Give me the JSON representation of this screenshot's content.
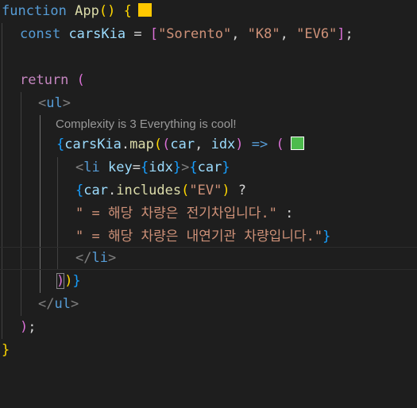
{
  "codelens": "Complexity is 3 Everything is cool!",
  "colors": {
    "color_swatch_1": "#ffc800",
    "color_swatch_2": "#4dbb4d"
  },
  "lines": {
    "l1": {
      "t1": "function",
      "t2": " ",
      "t3": "App",
      "t4": "()",
      "t5": " ",
      "t6": "{"
    },
    "l2": {
      "t1": "const",
      "t2": " ",
      "t3": "carsKia",
      "t4": " = ",
      "t5": "[",
      "t6": "\"Sorento\"",
      "t7": ", ",
      "t8": "\"K8\"",
      "t9": ", ",
      "t10": "\"EV6\"",
      "t11": "]",
      "t12": ";"
    },
    "l4": {
      "t1": "return",
      "t2": " ",
      "t3": "("
    },
    "l5": {
      "t1": "<",
      "t2": "ul",
      "t3": ">"
    },
    "l6": {
      "t1": "{",
      "t2": "carsKia",
      "t3": ".",
      "t4": "map",
      "t5": "(",
      "t6": "(",
      "t7": "car",
      "t8": ", ",
      "t9": "idx",
      "t10": ")",
      "t11": " => ",
      "t12": "("
    },
    "l7": {
      "t1": "<",
      "t2": "li",
      "t3": " ",
      "t4": "key",
      "t5": "=",
      "t6": "{",
      "t7": "idx",
      "t8": "}",
      "t9": ">",
      "t10": "{",
      "t11": "car",
      "t12": "}"
    },
    "l8": {
      "t1": "{",
      "t2": "car",
      "t3": ".",
      "t4": "includes",
      "t5": "(",
      "t6": "\"EV\"",
      "t7": ")",
      "t8": " ?"
    },
    "l9": {
      "t1": "\" = 해당 차량은 전기차입니다.\"",
      "t2": " :"
    },
    "l10": {
      "t1": "\" = 해당 차량은 내연기관 차량입니다.\"",
      "t2": "}"
    },
    "l11": {
      "t1": "</",
      "t2": "li",
      "t3": ">"
    },
    "l12": {
      "t1": ")",
      "t2": ")",
      "t3": "}"
    },
    "l13": {
      "t1": "</",
      "t2": "ul",
      "t3": ">"
    },
    "l14": {
      "t1": ")",
      "t2": ";"
    },
    "l15": {
      "t1": "}"
    }
  }
}
